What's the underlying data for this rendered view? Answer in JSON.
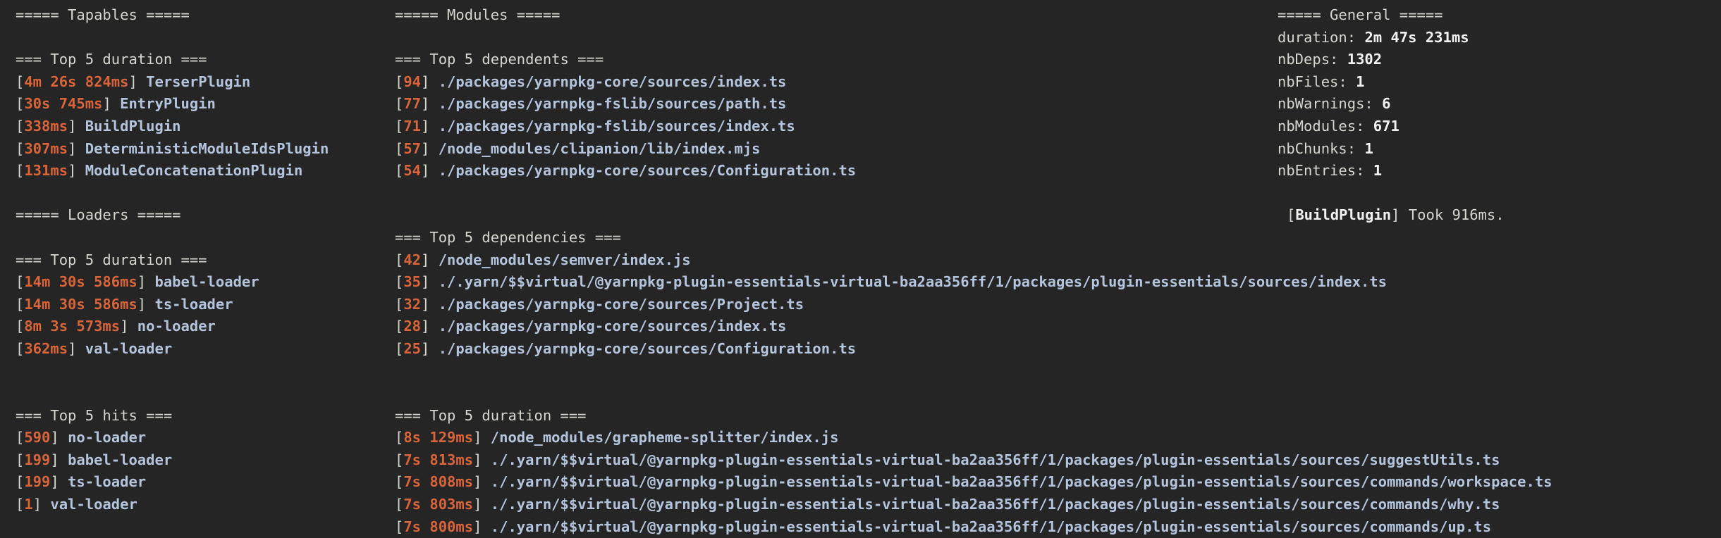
{
  "terminal": {
    "background_color": "#252526",
    "colors": {
      "header": "#d4d7ce",
      "metric": "#d9643a",
      "name": "#b3c4dc",
      "value": "#f2f2f2"
    }
  },
  "tapables": {
    "header": "===== Tapables =====",
    "duration_header": "=== Top 5 duration ===",
    "duration_rows": [
      {
        "metric": "4m 26s 824ms",
        "name": "TerserPlugin"
      },
      {
        "metric": "30s 745ms",
        "name": "EntryPlugin"
      },
      {
        "metric": "338ms",
        "name": "BuildPlugin"
      },
      {
        "metric": "307ms",
        "name": "DeterministicModuleIdsPlugin"
      },
      {
        "metric": "131ms",
        "name": "ModuleConcatenationPlugin"
      }
    ]
  },
  "loaders": {
    "header": "===== Loaders =====",
    "duration_header": "=== Top 5 duration ===",
    "duration_rows": [
      {
        "metric": "14m 30s 586ms",
        "name": "babel-loader"
      },
      {
        "metric": "14m 30s 586ms",
        "name": "ts-loader"
      },
      {
        "metric": "8m 3s 573ms",
        "name": "no-loader"
      },
      {
        "metric": "362ms",
        "name": "val-loader"
      }
    ],
    "hits_header": "=== Top 5 hits ===",
    "hits_rows": [
      {
        "metric": "590",
        "name": "no-loader"
      },
      {
        "metric": "199",
        "name": "babel-loader"
      },
      {
        "metric": "199",
        "name": "ts-loader"
      },
      {
        "metric": "1",
        "name": "val-loader"
      }
    ]
  },
  "modules": {
    "header": "===== Modules =====",
    "dependents_header": "=== Top 5 dependents ===",
    "dependents_rows": [
      {
        "metric": "94",
        "name": "./packages/yarnpkg-core/sources/index.ts"
      },
      {
        "metric": "77",
        "name": "./packages/yarnpkg-fslib/sources/path.ts"
      },
      {
        "metric": "71",
        "name": "./packages/yarnpkg-fslib/sources/index.ts"
      },
      {
        "metric": "57",
        "name": "/node_modules/clipanion/lib/index.mjs"
      },
      {
        "metric": "54",
        "name": "./packages/yarnpkg-core/sources/Configuration.ts"
      }
    ],
    "dependencies_header": "=== Top 5 dependencies ===",
    "dependencies_rows": [
      {
        "metric": "42",
        "name": "/node_modules/semver/index.js"
      },
      {
        "metric": "35",
        "name": "./.yarn/$$virtual/@yarnpkg-plugin-essentials-virtual-ba2aa356ff/1/packages/plugin-essentials/sources/index.ts"
      },
      {
        "metric": "32",
        "name": "./packages/yarnpkg-core/sources/Project.ts"
      },
      {
        "metric": "28",
        "name": "./packages/yarnpkg-core/sources/index.ts"
      },
      {
        "metric": "25",
        "name": "./packages/yarnpkg-core/sources/Configuration.ts"
      }
    ],
    "duration_header": "=== Top 5 duration ===",
    "duration_rows": [
      {
        "metric": "8s 129ms",
        "name": "/node_modules/grapheme-splitter/index.js"
      },
      {
        "metric": "7s 813ms",
        "name": "./.yarn/$$virtual/@yarnpkg-plugin-essentials-virtual-ba2aa356ff/1/packages/plugin-essentials/sources/suggestUtils.ts"
      },
      {
        "metric": "7s 808ms",
        "name": "./.yarn/$$virtual/@yarnpkg-plugin-essentials-virtual-ba2aa356ff/1/packages/plugin-essentials/sources/commands/workspace.ts"
      },
      {
        "metric": "7s 803ms",
        "name": "./.yarn/$$virtual/@yarnpkg-plugin-essentials-virtual-ba2aa356ff/1/packages/plugin-essentials/sources/commands/why.ts"
      },
      {
        "metric": "7s 800ms",
        "name": "./.yarn/$$virtual/@yarnpkg-plugin-essentials-virtual-ba2aa356ff/1/packages/plugin-essentials/sources/commands/up.ts"
      }
    ]
  },
  "general": {
    "header": "===== General =====",
    "stats": [
      {
        "key": "duration:",
        "value": "2m 47s 231ms"
      },
      {
        "key": "nbDeps:",
        "value": "1302"
      },
      {
        "key": "nbFiles:",
        "value": "1"
      },
      {
        "key": "nbWarnings:",
        "value": "6"
      },
      {
        "key": "nbModules:",
        "value": "671"
      },
      {
        "key": "nbChunks:",
        "value": "1"
      },
      {
        "key": "nbEntries:",
        "value": "1"
      }
    ],
    "note": {
      "open_bracket": "[",
      "plugin": "BuildPlugin",
      "close_bracket": "]",
      "text": " Took 916ms."
    }
  }
}
